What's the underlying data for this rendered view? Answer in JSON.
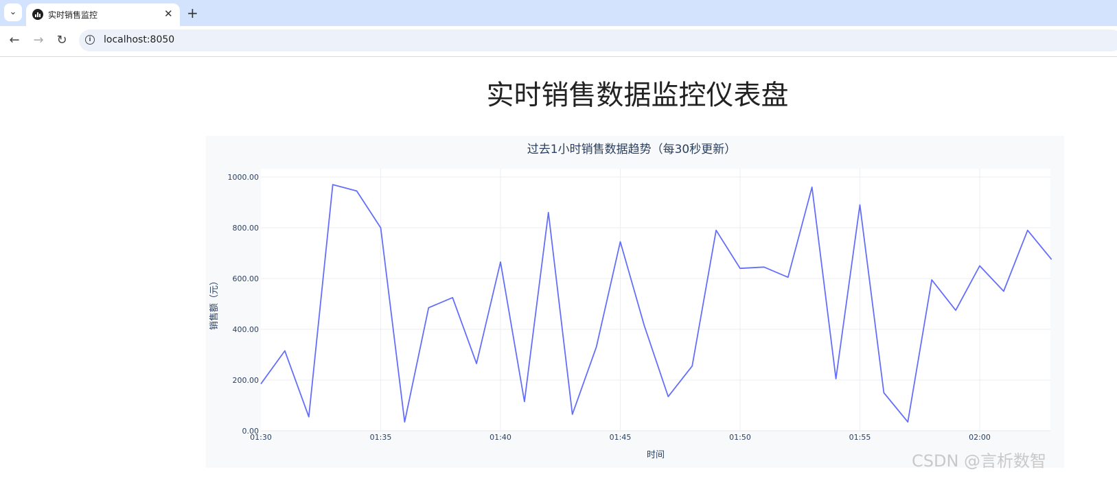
{
  "browser": {
    "tab_title": "实时销售监控",
    "url": "localhost:8050",
    "dropdown_glyph": "⌄",
    "close_glyph": "✕",
    "new_tab_glyph": "+",
    "back_glyph": "←",
    "forward_glyph": "→",
    "reload_glyph": "↻",
    "info_glyph": "i"
  },
  "page": {
    "title": "实时销售数据监控仪表盘"
  },
  "chart_data": {
    "type": "line",
    "title": "过去1小时销售数据趋势（每30秒更新）",
    "xlabel": "时间",
    "ylabel": "销售额（元）",
    "x_tick_labels": [
      "01:30",
      "01:35",
      "01:40",
      "01:45",
      "01:50",
      "01:55",
      "02:00"
    ],
    "y_tick_labels": [
      "0.00",
      "200.00",
      "400.00",
      "600.00",
      "800.00",
      "1000.00"
    ],
    "ylim": [
      0,
      1000
    ],
    "grid": true,
    "line_color": "#636efa",
    "x": [
      "01:30",
      "01:31",
      "01:32",
      "01:33",
      "01:34",
      "01:35",
      "01:36",
      "01:37",
      "01:38",
      "01:39",
      "01:40",
      "01:41",
      "01:42",
      "01:43",
      "01:44",
      "01:45",
      "01:46",
      "01:47",
      "01:48",
      "01:49",
      "01:50",
      "01:51",
      "01:52",
      "01:53",
      "01:54",
      "01:55",
      "01:56",
      "01:57",
      "01:58",
      "01:59",
      "02:00",
      "02:01",
      "02:02",
      "02:03"
    ],
    "series": [
      {
        "values": [
          185,
          315,
          55,
          970,
          945,
          800,
          35,
          485,
          525,
          265,
          665,
          115,
          860,
          65,
          330,
          745,
          415,
          135,
          255,
          790,
          640,
          645,
          605,
          960,
          205,
          890,
          150,
          35,
          595,
          475,
          650,
          550,
          790,
          675
        ]
      }
    ]
  },
  "watermark": "CSDN @言析数智"
}
